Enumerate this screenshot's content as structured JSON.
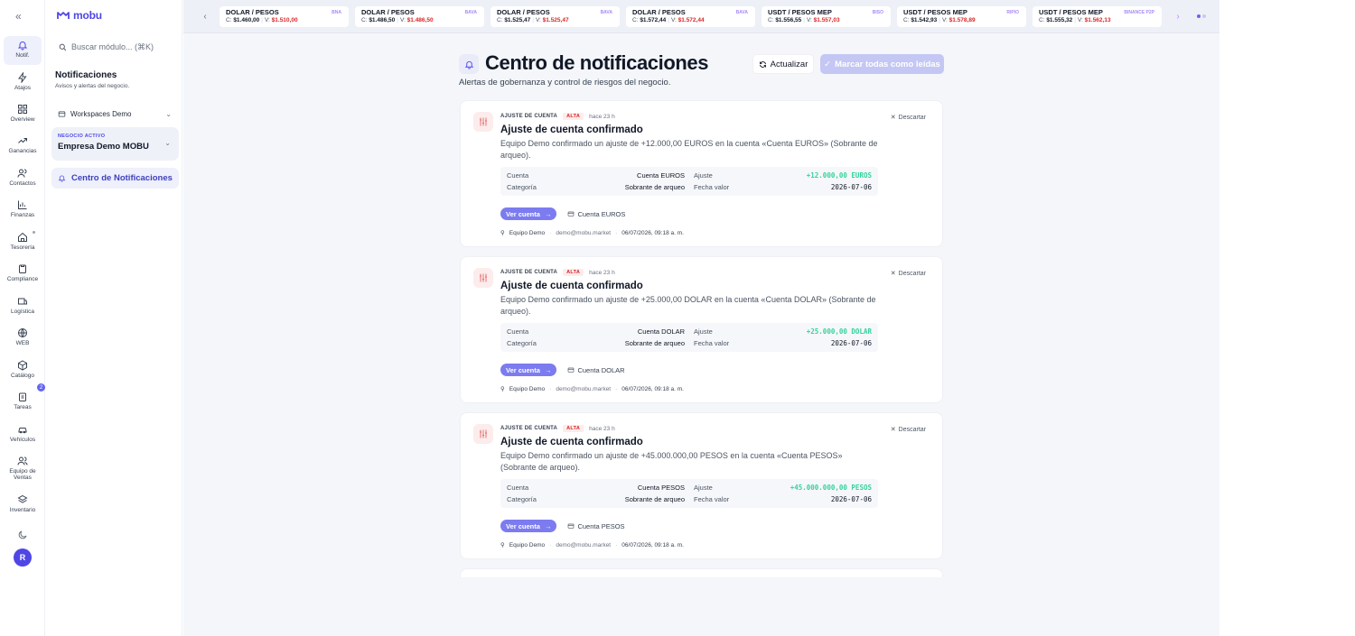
{
  "rail": {
    "items": [
      {
        "label": "Notif.",
        "icon": "bell-icon"
      },
      {
        "label": "Atajos",
        "icon": "lightning-icon"
      },
      {
        "label": "Overview",
        "icon": "grid-icon"
      },
      {
        "label": "Ganancias",
        "icon": "trend-icon"
      },
      {
        "label": "Contactos",
        "icon": "users-icon"
      },
      {
        "label": "Finanzas",
        "icon": "bar-chart-icon"
      },
      {
        "label": "Tesorería",
        "icon": "home-icon"
      },
      {
        "label": "Compliance",
        "icon": "clipboard-icon"
      },
      {
        "label": "Logística",
        "icon": "box-icon"
      },
      {
        "label": "WEB",
        "icon": "globe-icon"
      },
      {
        "label": "Catálogo",
        "icon": "package-icon"
      },
      {
        "label": "Tareas",
        "icon": "tasks-icon"
      },
      {
        "label": "Vehículos",
        "icon": "car-icon"
      },
      {
        "label": "Equipo de Ventas",
        "icon": "team-icon"
      },
      {
        "label": "Inventario",
        "icon": "layers-icon"
      }
    ],
    "tasks_badge": "2",
    "avatar_initial": "R"
  },
  "panel": {
    "logo": "mobu",
    "search_placeholder": "Buscar módulo... (⌘K)",
    "title": "Notificaciones",
    "subtitle": "Avisos y alertas del negocio.",
    "workspace": "Workspaces Demo",
    "business_label": "NEGOCIO ACTIVO",
    "business_name": "Empresa Demo MOBU",
    "selected_nav": "Centro de Notificaciones"
  },
  "ticker": [
    {
      "pair": "DOLAR / PESOS",
      "source": "BNA",
      "buy_label": "C:",
      "buy": "$1.460,00",
      "sell_label": "V:",
      "sell": "$1.510,00"
    },
    {
      "pair": "DOLAR / PESOS",
      "source": "BAVA",
      "buy_label": "C:",
      "buy": "$1.486,50",
      "sell_label": "V:",
      "sell": "$1.486,50"
    },
    {
      "pair": "DOLAR / PESOS",
      "source": "BAVA",
      "buy_label": "C:",
      "buy": "$1.525,47",
      "sell_label": "V:",
      "sell": "$1.525,47"
    },
    {
      "pair": "DOLAR / PESOS",
      "source": "BAVA",
      "buy_label": "C:",
      "buy": "$1.572,44",
      "sell_label": "V:",
      "sell": "$1.572,44"
    },
    {
      "pair": "USDT / PESOS MEP",
      "source": "BISO",
      "buy_label": "C:",
      "buy": "$1.556,55",
      "sell_label": "V:",
      "sell": "$1.557,03"
    },
    {
      "pair": "USDT / PESOS MEP",
      "source": "RIPIO",
      "buy_label": "C:",
      "buy": "$1.542,93",
      "sell_label": "V:",
      "sell": "$1.578,89"
    },
    {
      "pair": "USDT / PESOS MEP",
      "source": "BINANCE P2P",
      "buy_label": "C:",
      "buy": "$1.555,32",
      "sell_label": "V:",
      "sell": "$1.562,13"
    }
  ],
  "header": {
    "title": "Centro de notificaciones",
    "subtitle": "Alertas de gobernanza y control de riesgos del negocio.",
    "refresh_label": "Actualizar",
    "mark_all_label": "Marcar todas como leídas"
  },
  "notifications": [
    {
      "kind": "AJUSTE DE CUENTA",
      "priority": "ALTA",
      "ago": "hace 23 h",
      "dismiss": "Descartar",
      "title": "Ajuste de cuenta confirmado",
      "body": "Equipo Demo confirmado un ajuste de +12.000,00 EUROS en la cuenta «Cuenta EUROS» (Sobrante de arqueo).",
      "k_account": "Cuenta",
      "account": "Cuenta EUROS",
      "k_adjust": "Ajuste",
      "adjust": "+12.000,00 EUROS",
      "k_category": "Categoría",
      "category": "Sobrante de arqueo",
      "k_date": "Fecha valor",
      "date": "2026-07-06",
      "view_label": "Ver cuenta",
      "chip": "Cuenta EUROS",
      "user": "Equipo Demo",
      "email": "demo@mobu.market",
      "timestamp": "06/07/2026, 09:18 a. m."
    },
    {
      "kind": "AJUSTE DE CUENTA",
      "priority": "ALTA",
      "ago": "hace 23 h",
      "dismiss": "Descartar",
      "title": "Ajuste de cuenta confirmado",
      "body": "Equipo Demo confirmado un ajuste de +25.000,00 DOLAR en la cuenta «Cuenta DOLAR» (Sobrante de arqueo).",
      "k_account": "Cuenta",
      "account": "Cuenta DOLAR",
      "k_adjust": "Ajuste",
      "adjust": "+25.000,00 DOLAR",
      "k_category": "Categoría",
      "category": "Sobrante de arqueo",
      "k_date": "Fecha valor",
      "date": "2026-07-06",
      "view_label": "Ver cuenta",
      "chip": "Cuenta DOLAR",
      "user": "Equipo Demo",
      "email": "demo@mobu.market",
      "timestamp": "06/07/2026, 09:18 a. m."
    },
    {
      "kind": "AJUSTE DE CUENTA",
      "priority": "ALTA",
      "ago": "hace 23 h",
      "dismiss": "Descartar",
      "title": "Ajuste de cuenta confirmado",
      "body": "Equipo Demo confirmado un ajuste de +45.000.000,00 PESOS en la cuenta «Cuenta PESOS» (Sobrante de arqueo).",
      "k_account": "Cuenta",
      "account": "Cuenta PESOS",
      "k_adjust": "Ajuste",
      "adjust": "+45.000.000,00 PESOS",
      "k_category": "Categoría",
      "category": "Sobrante de arqueo",
      "k_date": "Fecha valor",
      "date": "2026-07-06",
      "view_label": "Ver cuenta",
      "chip": "Cuenta PESOS",
      "user": "Equipo Demo",
      "email": "demo@mobu.market",
      "timestamp": "06/07/2026, 09:18 a. m."
    }
  ],
  "colors": {
    "accent": "#4f46e5",
    "priority": "#dc2626",
    "amount": "#34d399"
  }
}
